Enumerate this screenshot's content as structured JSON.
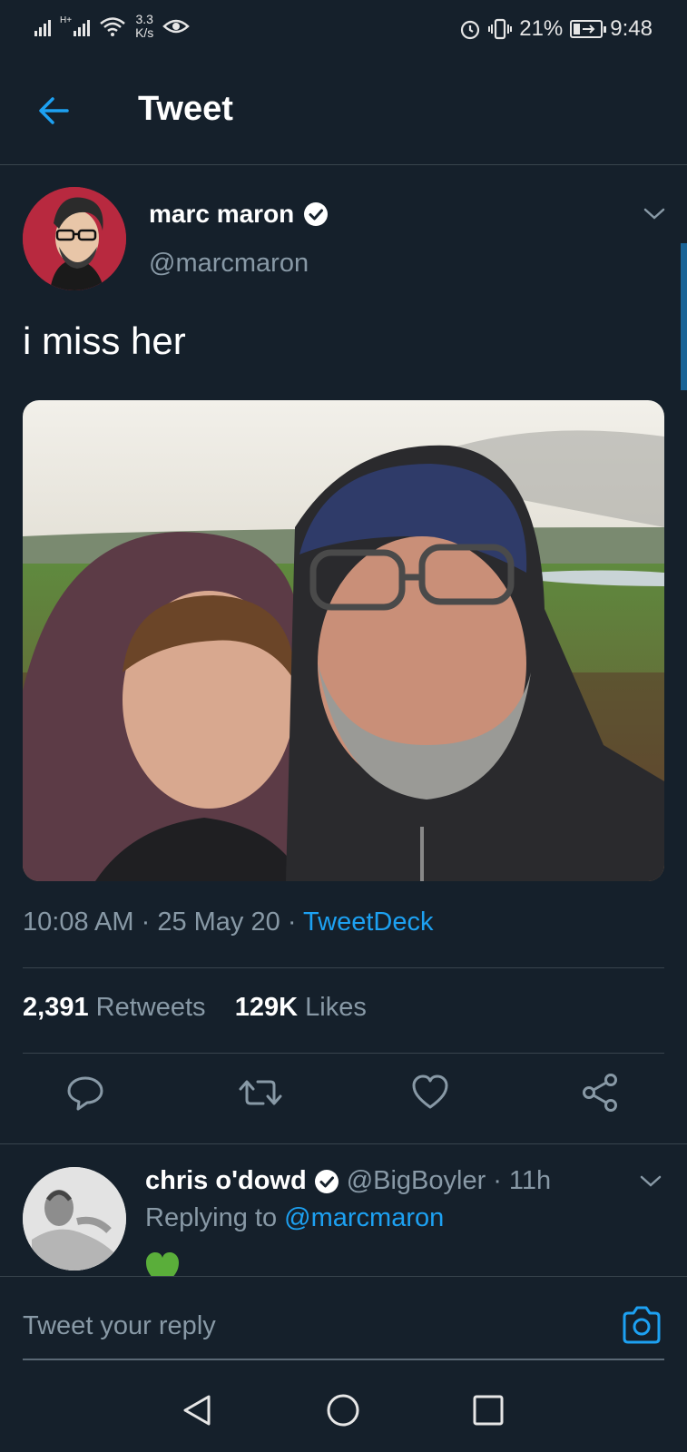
{
  "status_bar": {
    "network_type": "H+",
    "speed_value": "3.3",
    "speed_unit": "K/s",
    "battery_percent": "21%",
    "time": "9:48"
  },
  "header": {
    "title": "Tweet",
    "back_icon": "arrow-left-icon"
  },
  "tweet": {
    "author_name": "marc maron",
    "author_handle": "@marcmaron",
    "verified": true,
    "text": "i miss her",
    "time": "10:08 AM",
    "date": "25 May 20",
    "separator": "·",
    "source": "TweetDeck",
    "retweets_count": "2,391",
    "retweets_label": "Retweets",
    "likes_count": "129K",
    "likes_label": "Likes",
    "actions": [
      "reply-icon",
      "retweet-icon",
      "like-icon",
      "share-icon"
    ]
  },
  "reply": {
    "author_name": "chris o'dowd",
    "author_handle": "@BigBoyler",
    "separator": "·",
    "time": "11h",
    "replying_prefix": "Replying to",
    "replying_to": "@marcmaron",
    "content_emoji": "green-heart"
  },
  "composer": {
    "placeholder": "Tweet your reply",
    "camera_icon": "camera-icon"
  },
  "nav": {
    "buttons": [
      "back-triangle-icon",
      "home-circle-icon",
      "recents-square-icon"
    ]
  },
  "colors": {
    "background": "#15202b",
    "accent": "#1da1f2",
    "secondary_text": "#8899a6",
    "divider": "#38444d"
  }
}
